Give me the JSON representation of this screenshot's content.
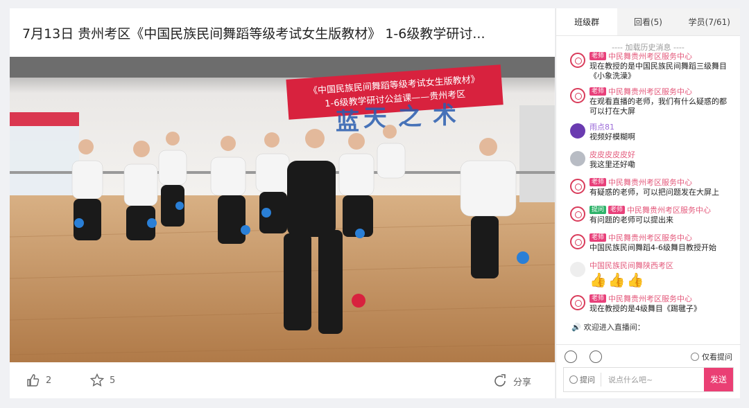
{
  "title": "7月13日 贵州考区《中国民族民间舞蹈等级考试女生版教材》 1-6级教学研讨...",
  "video": {
    "banner_line1": "《中国民族民间舞蹈等级考试女生版教材》",
    "banner_line2": "1-6级教学研讨公益课——贵州考区"
  },
  "footer": {
    "like_count": "2",
    "star_count": "5",
    "share_label": "分享"
  },
  "tabs": [
    {
      "label": "班级群"
    },
    {
      "label": "回看(5)"
    },
    {
      "label": "学员(7/61)"
    }
  ],
  "history_label": "---- 加载历史消息 ----",
  "messages": [
    {
      "badge": "老师",
      "name": "中民舞贵州考区服务中心",
      "text": "现在教授的是中国民族民间舞蹈三级舞目《小象洗澡》"
    },
    {
      "badge": "老师",
      "name": "中民舞贵州考区服务中心",
      "text": "在观看直播的老师，我们有什么疑惑的都可以打在大屏"
    },
    {
      "name": "雨点81",
      "text": "视频好模糊啊"
    },
    {
      "name": "皮皮皮皮皮好",
      "text": "我这里还好嘞"
    },
    {
      "badge": "老师",
      "name": "中民舞贵州考区服务中心",
      "text": "有疑惑的老师，可以把问题发在大屏上"
    },
    {
      "badge_green": "提问",
      "badge": "老师",
      "name": "中民舞贵州考区服务中心",
      "text": "有问题的老师可以提出来"
    },
    {
      "badge": "老师",
      "name": "中民舞贵州考区服务中心",
      "text": "中国民族民间舞蹈4-6级舞目教授开始"
    },
    {
      "name": "中国民族民间舞陕西考区",
      "thumbs": "👍👍👍"
    },
    {
      "badge": "老师",
      "name": "中民舞贵州考区服务中心",
      "text": "现在教授的是4级舞目《踢毽子》"
    }
  ],
  "welcome_text": "欢迎进入直播间：",
  "only_question_label": "仅看提问",
  "ask_label": "提问",
  "input_placeholder": "说点什么吧~",
  "send_label": "发送",
  "colors": {
    "accent": "#ea3f74",
    "teacher_badge": "#e8407a",
    "banner": "#d8223e"
  }
}
